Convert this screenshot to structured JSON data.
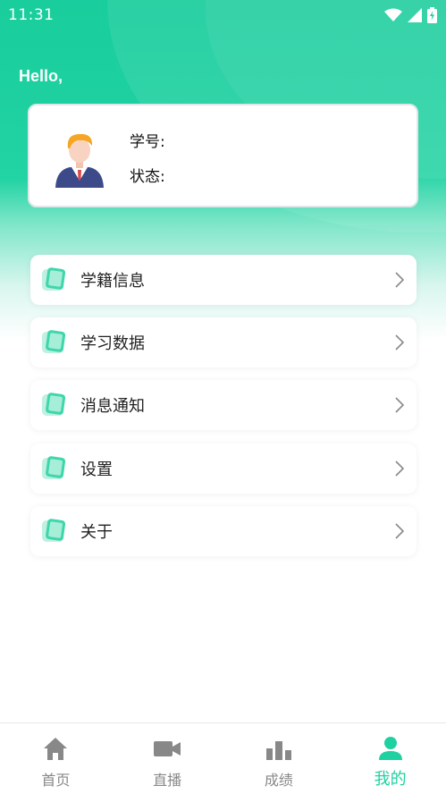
{
  "status_bar": {
    "time": "11:31"
  },
  "header": {
    "greeting": "Hello,"
  },
  "profile": {
    "student_id_label": "学号:",
    "status_label": "状态:"
  },
  "menu": {
    "items": [
      {
        "label": "学籍信息"
      },
      {
        "label": "学习数据"
      },
      {
        "label": "消息通知"
      },
      {
        "label": "设置"
      },
      {
        "label": "关于"
      }
    ]
  },
  "tabbar": {
    "tabs": [
      {
        "label": "首页",
        "icon": "home-icon"
      },
      {
        "label": "直播",
        "icon": "video-camera-icon"
      },
      {
        "label": "成绩",
        "icon": "bar-chart-icon"
      },
      {
        "label": "我的",
        "icon": "person-icon"
      }
    ],
    "active_index": 3
  },
  "colors": {
    "accent": "#1fd1a0",
    "header_green": "#19cd9c",
    "inactive_tab": "#888888"
  }
}
